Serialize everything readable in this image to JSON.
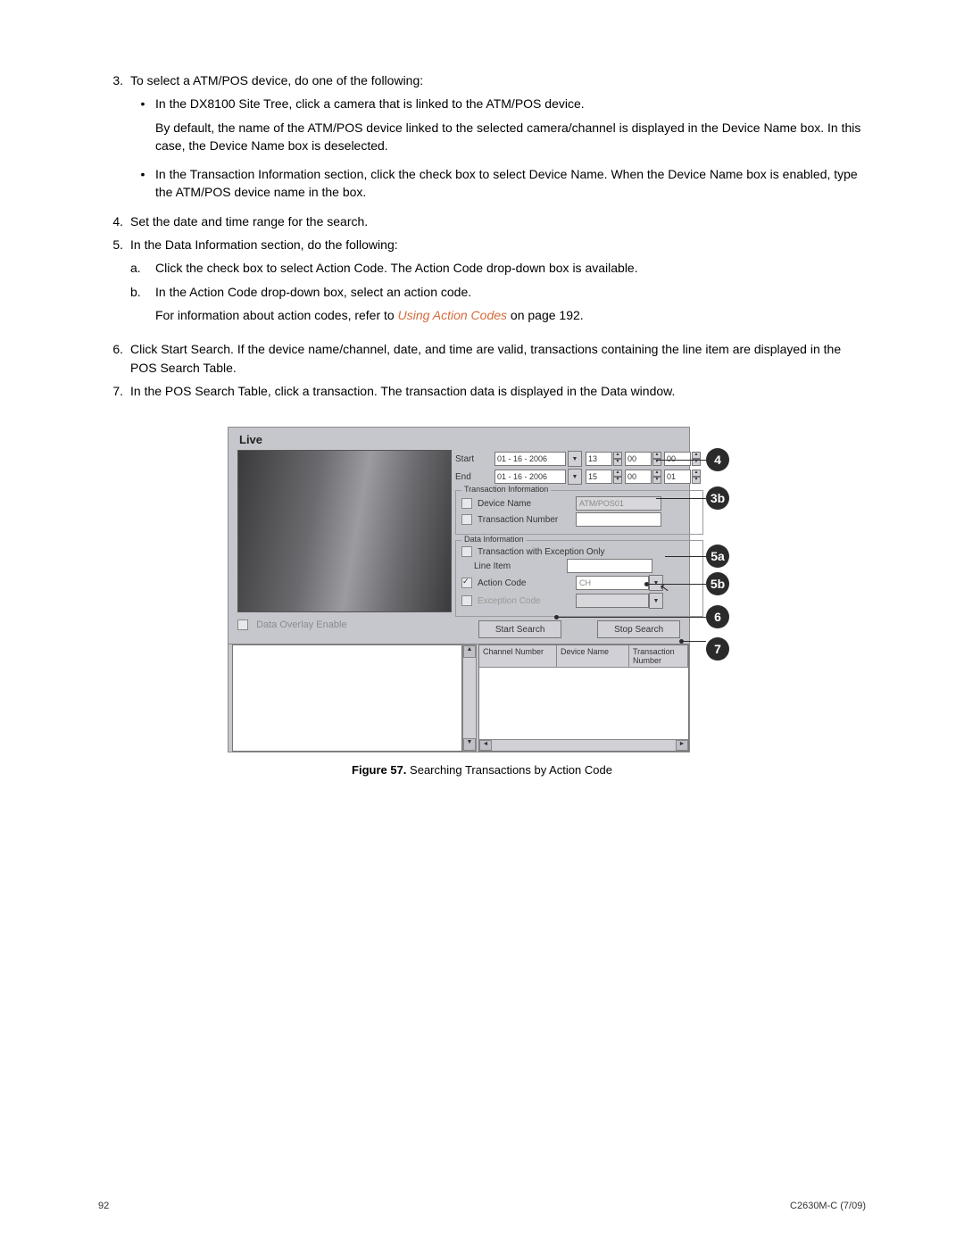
{
  "steps": {
    "s3": {
      "num": "3.",
      "text": "To select a ATM/POS device, do one of the following:",
      "b1": "In the DX8100 Site Tree, click a camera that is linked to the ATM/POS device.",
      "b1p": "By default, the name of the ATM/POS device linked to the selected camera/channel is displayed in the Device Name box. In this case, the Device Name box is deselected.",
      "b2": "In the Transaction Information section, click the check box to select Device Name. When the Device Name box is enabled, type the ATM/POS device name in the box."
    },
    "s4": {
      "num": "4.",
      "text": "Set the date and time range for the search."
    },
    "s5": {
      "num": "5.",
      "text": "In the Data Information section, do the following:",
      "a": "Click the check box to select Action Code. The Action Code drop-down box is available.",
      "b": "In the Action Code drop-down box, select an action code.",
      "bp_pre": "For information about action codes, refer to ",
      "bp_link": "Using Action Codes",
      "bp_post": " on page 192."
    },
    "s6": {
      "num": "6.",
      "text": "Click Start Search. If the device name/channel, date, and time are valid, transactions containing the line item are displayed in the POS Search Table."
    },
    "s7": {
      "num": "7.",
      "text": "In the POS Search Table, click a transaction. The transaction data is displayed in the Data window."
    }
  },
  "fig": {
    "live": "Live",
    "overlay": "Data Overlay Enable",
    "start": "Start",
    "end": "End",
    "date1": "01 - 16 - 2006",
    "date2": "01 - 16 - 2006",
    "h1": "13",
    "m1": "00",
    "s1": "00",
    "h2": "15",
    "m2": "00",
    "s2": "01",
    "ti_title": "Transaction Information",
    "ti_dev": "Device Name",
    "ti_dev_val": "ATM/POS01",
    "ti_tn": "Transaction Number",
    "di_title": "Data Information",
    "di_exc": "Transaction with Exception Only",
    "di_line": "Line Item",
    "di_ac": "Action Code",
    "di_ac_val": "CH",
    "di_ec": "Exception Code",
    "btn_start": "Start Search",
    "btn_stop": "Stop Search",
    "col1": "Channel Number",
    "col2": "Device Name",
    "col3": "Transaction Number"
  },
  "callouts": {
    "c4": "4",
    "c3b": "3b",
    "c5a": "5a",
    "c5b": "5b",
    "c6": "6",
    "c7": "7"
  },
  "caption": {
    "bold": "Figure 57.",
    "rest": "  Searching Transactions by Action Code"
  },
  "footer": {
    "page": "92",
    "doc": "C2630M-C (7/09)"
  }
}
